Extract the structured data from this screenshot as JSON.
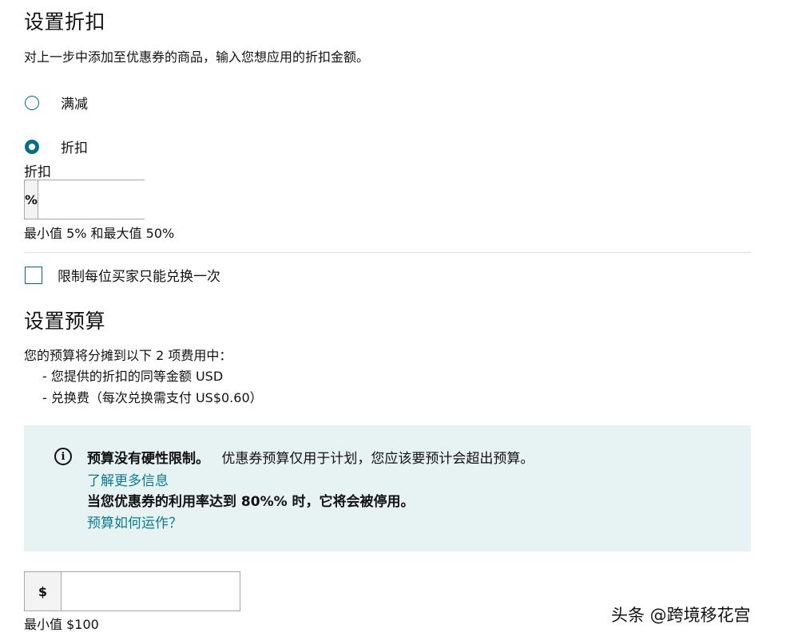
{
  "discount": {
    "title": "设置折扣",
    "description": "对上一步中添加至优惠券的商品，输入您想应用的折扣金额。",
    "options": [
      {
        "label": "满减",
        "selected": false
      },
      {
        "label": "折扣",
        "selected": true
      }
    ],
    "field_label": "折扣",
    "prefix": "%",
    "value": "",
    "hint": "最小值 5% 和最大值 50%"
  },
  "limit": {
    "label": "限制每位买家只能兑换一次",
    "checked": false
  },
  "budget": {
    "title": "设置预算",
    "intro": "您的预算将分摊到以下 2 项费用中：",
    "items": [
      "- 您提供的折扣的同等金额 USD",
      "- 兑换费（每次兑换需支付 US$0.60）"
    ],
    "info": {
      "icon": "info-icon",
      "bold_text": "预算没有硬性限制。",
      "text": "优惠券预算仅用于计划，您应该要预计会超出预算。",
      "learn_more": "了解更多信息",
      "warning": "当您优惠券的利用率达到 80%% 时，它将会被停用。",
      "how_link": "预算如何运作？"
    },
    "prefix": "$",
    "value": "",
    "hint": "最小值 $100"
  },
  "watermark": "头条 @跨境移花宫",
  "colors": {
    "accent": "#007185",
    "link": "#0a7b91",
    "info_bg": "#e7f2f3"
  }
}
